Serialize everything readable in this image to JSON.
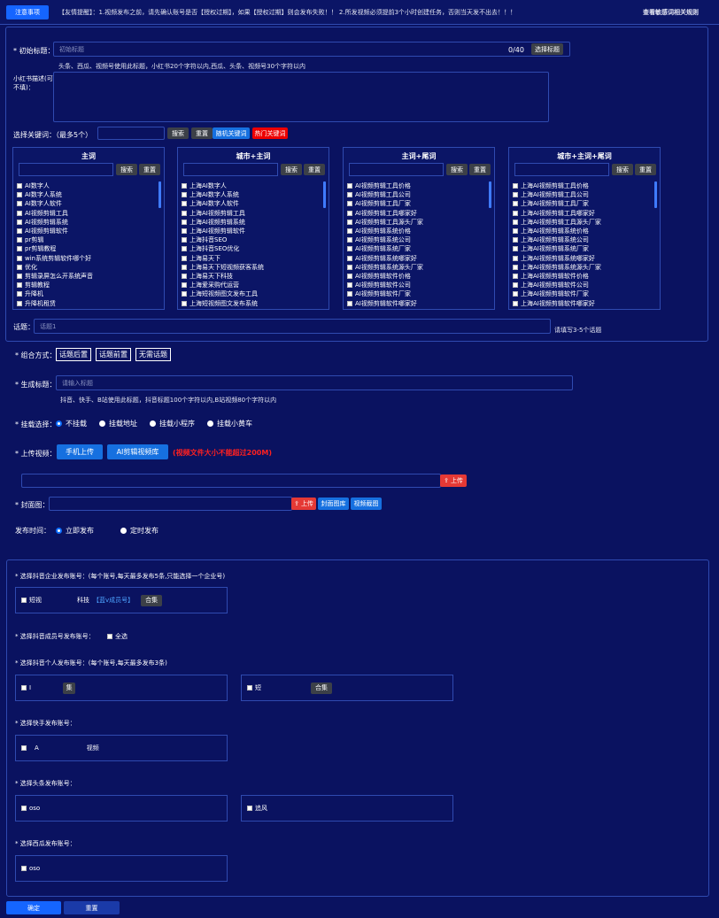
{
  "notice": {
    "tag": "注意事项",
    "text": "【友情提醒】：1.视频发布之前，请先确认账号是否【授权过期】，如果【授权过期】则会发布失败！！ 2.所发视频必须提前3个小时创建任务，否则当天发不出去！！！",
    "link": "查看敏感词相关规则"
  },
  "form": {
    "initial_title_label": "* 初始标题：",
    "initial_title_placeholder": "初始标题",
    "initial_title_counter": "0/40",
    "select_title_btn": "选择标题",
    "initial_title_hint": "头条、西瓜、视频号使用此标题，小红书20个字符以内,西瓜、头条、视频号30个字符以内",
    "xhs_label_line1": "小红书描述(可",
    "xhs_label_line2": "不填)：",
    "keyword_label": "选择关键词：（最多5个）",
    "search_btn": "搜索",
    "reset_btn": "重置",
    "random_btn": "随机关键词",
    "hot_btn": "热门关键词",
    "topic_label": "话题：",
    "topic_placeholder": "话题1",
    "topic_hint": "请填写3-5个话题",
    "combo_label": "* 组合方式：",
    "combos": [
      "话题后置",
      "话题前置",
      "无需话题"
    ],
    "gen_title_label": "* 生成标题：",
    "gen_title_placeholder": "请输入标题",
    "gen_title_hint": "抖音、快手、B站使用此标题，抖音标题100个字符以内,B站视频80个字符以内",
    "mount_label": "* 挂载选择：",
    "mount_options": [
      "不挂载",
      "挂载地址",
      "挂载小程序",
      "挂载小黄车"
    ],
    "upload_video_label": "* 上传视频：",
    "phone_upload_btn": "手机上传",
    "ai_library_btn": "AI剪辑视频库",
    "video_size_warning": "(视频文件大小不能超过200M)",
    "upload_btn": "上传",
    "cover_label": "* 封面图：",
    "cover_library_btn": "封面图库",
    "video_capture_btn": "视频截图",
    "publish_time_label": "发布时间：",
    "publish_options": [
      "立即发布",
      "定时发布"
    ]
  },
  "keyword_boxes": [
    {
      "title": "主词",
      "items": [
        "AI数字人",
        "AI数字人系统",
        "AI数字人软件",
        "AI视频剪辑工具",
        "AI视频剪辑系统",
        "AI视频剪辑软件",
        "pr剪辑",
        "pr剪辑教程",
        "win系统剪辑软件哪个好",
        "优化",
        "剪辑录屏怎么开系统声音",
        "剪辑教程",
        "升降机",
        "升降机租赁"
      ]
    },
    {
      "title": "城市+主词",
      "items": [
        "上海AI数字人",
        "上海AI数字人系统",
        "上海AI数字人软件",
        "上海AI视频剪辑工具",
        "上海AI视频剪辑系统",
        "上海AI视频剪辑软件",
        "上海抖音SEO",
        "上海抖音SEO优化",
        "上海易天下",
        "上海易天下短视频获客系统",
        "上海易天下科技",
        "上海爱采购代运营",
        "上海短视频图文发布工具",
        "上海短视频图文发布系统"
      ]
    },
    {
      "title": "主词+尾词",
      "items": [
        "AI视频剪辑工具价格",
        "AI视频剪辑工具公司",
        "AI视频剪辑工具厂家",
        "AI视频剪辑工具哪家好",
        "AI视频剪辑工具源头厂家",
        "AI视频剪辑系统价格",
        "AI视频剪辑系统公司",
        "AI视频剪辑系统厂家",
        "AI视频剪辑系统哪家好",
        "AI视频剪辑系统源头厂家",
        "AI视频剪辑软件价格",
        "AI视频剪辑软件公司",
        "AI视频剪辑软件厂家",
        "AI视频剪辑软件哪家好"
      ]
    },
    {
      "title": "城市+主词+尾词",
      "items": [
        "上海AI视频剪辑工具价格",
        "上海AI视频剪辑工具公司",
        "上海AI视频剪辑工具厂家",
        "上海AI视频剪辑工具哪家好",
        "上海AI视频剪辑工具源头厂家",
        "上海AI视频剪辑系统价格",
        "上海AI视频剪辑系统公司",
        "上海AI视频剪辑系统厂家",
        "上海AI视频剪辑系统哪家好",
        "上海AI视频剪辑系统源头厂家",
        "上海AI视频剪辑软件价格",
        "上海AI视频剪辑软件公司",
        "上海AI视频剪辑软件厂家",
        "上海AI视频剪辑软件哪家好"
      ]
    }
  ],
  "accounts": {
    "douyin_enterprise_label": "* 选择抖音企业发布账号：(每个账号,每天最多发布5条,只能选择一个企业号)",
    "douyin_enterprise_account": {
      "prefix": "短视",
      "suffix": "科技",
      "tag": "【蓝v成员号】",
      "btn": "合集"
    },
    "douyin_member_label": "* 选择抖音成员号发布账号：",
    "select_all": "全选",
    "douyin_personal_label": "* 选择抖音个人发布账号：(每个账号,每天最多发布3条)",
    "douyin_personal_accounts": [
      {
        "name": "I",
        "btn": "集"
      },
      {
        "name": "短",
        "btn": "合集"
      }
    ],
    "kuaishou_label": "* 选择快手发布账号：",
    "kuaishou_account": {
      "prefix": "A",
      "suffix": "视频"
    },
    "toutiao_label": "* 选择头条发布账号：",
    "toutiao_accounts": [
      "oso",
      "追风"
    ],
    "xigua_label": "* 选择西瓜发布账号：",
    "xigua_account": "oso"
  },
  "footer": {
    "confirm": "确定",
    "reset": "重置"
  }
}
